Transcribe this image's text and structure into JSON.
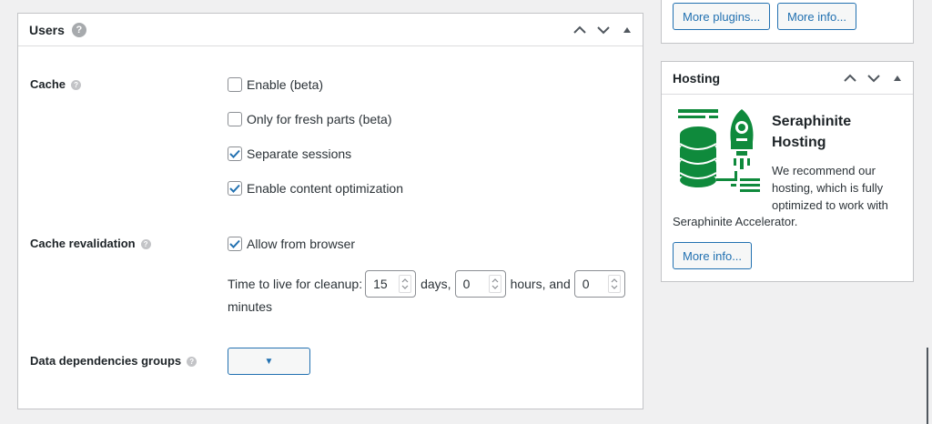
{
  "users_panel": {
    "title": "Users",
    "help": "?",
    "rows": {
      "cache": {
        "label": "Cache",
        "options": [
          {
            "label": "Enable (beta)",
            "checked": false
          },
          {
            "label": "Only for fresh parts (beta)",
            "checked": false
          },
          {
            "label": "Separate sessions",
            "checked": true
          },
          {
            "label": "Enable content optimization",
            "checked": true
          }
        ]
      },
      "revalidation": {
        "label": "Cache revalidation",
        "allow_label": "Allow from browser",
        "allow_checked": true,
        "ttl_prefix": "Time to live for cleanup:",
        "days_value": "15",
        "days_suffix": "days,",
        "hours_value": "0",
        "hours_suffix": "hours, and",
        "minutes_value": "0",
        "minutes_suffix": "minutes"
      },
      "deps": {
        "label": "Data dependencies groups",
        "dropdown_caret": "▼"
      }
    }
  },
  "top_right_panel": {
    "more_plugins_label": "More plugins...",
    "more_info_label": "More info..."
  },
  "hosting_panel": {
    "title": "Hosting",
    "name_line1": "Seraphinite",
    "name_line2": "Hosting",
    "desc_short": "We recommend our hosting, which is fully optimized to work with",
    "desc_tail": "Seraphinite Accelerator.",
    "more_info_label": "More info..."
  },
  "colors": {
    "accent": "#2271b1",
    "brand_green": "#0f8a3c",
    "border": "#c3c4c7"
  }
}
